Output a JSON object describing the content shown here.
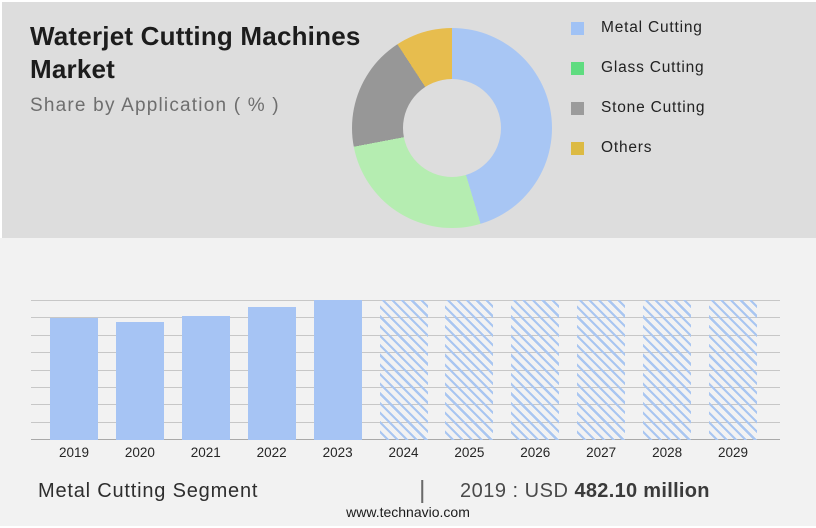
{
  "header": {
    "title": "Waterjet Cutting Machines Market",
    "subtitle": "Share by Application ( % )"
  },
  "colors": {
    "panel_bg": "#dddddd",
    "section_bg": "#f2f2f2",
    "gridline": "#c7c7c7",
    "axis": "#a9a9a9",
    "bar_blue": "#a6c4f4",
    "hatch_blue": "#a9c6f1"
  },
  "chart_data": [
    {
      "type": "pie",
      "donut": true,
      "title": "Share by Application ( % )",
      "labels": [
        "Metal Cutting",
        "Glass Cutting",
        "Stone Cutting",
        "Others"
      ],
      "values": [
        45.4,
        26.6,
        18.8,
        9.2
      ],
      "slice_colors": [
        "#a8c6f4",
        "#b5edb1",
        "#979797",
        "#e7bd4e"
      ],
      "legend_colors": [
        "#a0c2f5",
        "#5fdc80",
        "#9b9b9b",
        "#dcba43"
      ],
      "legend_position": "right",
      "start_angle_deg": 0,
      "direction": "clockwise"
    },
    {
      "type": "bar",
      "categories": [
        "2019",
        "2020",
        "2021",
        "2022",
        "2023",
        "2024",
        "2025",
        "2026",
        "2027",
        "2028",
        "2029"
      ],
      "series": [
        {
          "name": "Metal Cutting Segment",
          "unit": "USD million",
          "values": [
            482.1,
            467,
            491,
            523,
            551,
            null,
            null,
            null,
            null,
            null,
            null
          ]
        }
      ],
      "forecast_categories": [
        "2024",
        "2025",
        "2026",
        "2027",
        "2028",
        "2029"
      ],
      "forecast_style": "diagonal-hatch-full-height",
      "ylim": [
        0,
        552
      ],
      "gridline_count": 9,
      "grid": "horizontal-only",
      "labeled_value": "2019 : USD 482.10 million"
    }
  ],
  "footnote": {
    "segment_label": "Metal Cutting Segment",
    "separator": "|",
    "value_prefix": "2019 : USD ",
    "value_bold": "482.10 million"
  },
  "footer": {
    "website": "www.technavio.com"
  }
}
